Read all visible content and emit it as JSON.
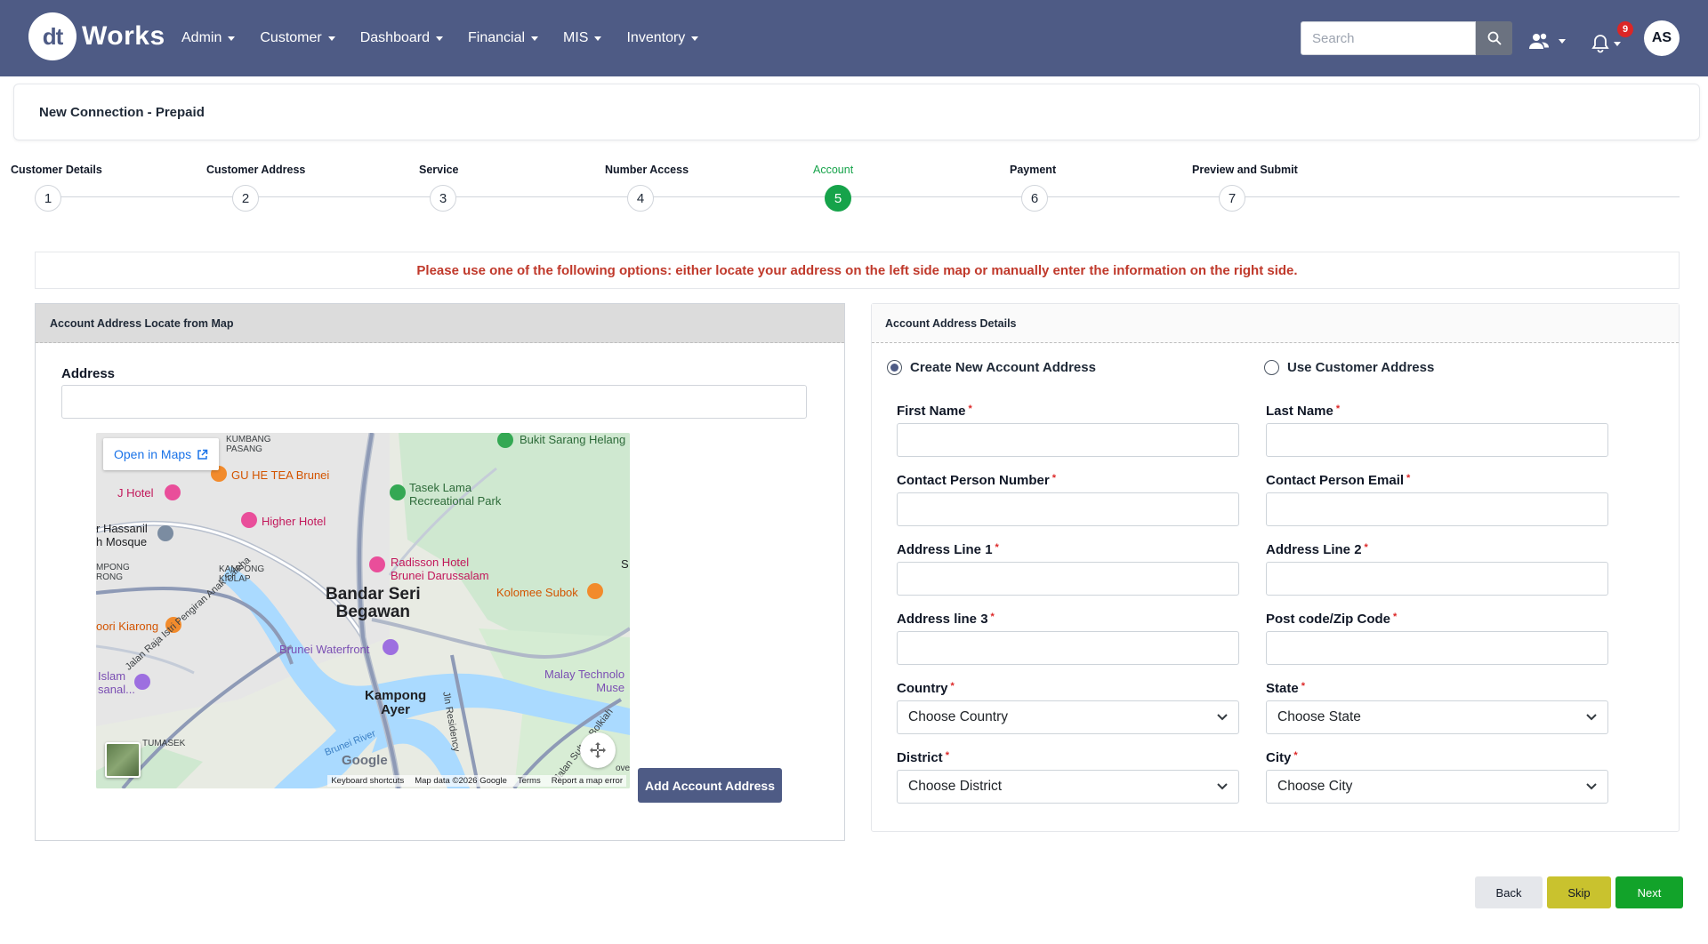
{
  "header": {
    "logo_mark": "dt",
    "logo_text": "Works",
    "nav": [
      "Admin",
      "Customer",
      "Dashboard",
      "Financial",
      "MIS",
      "Inventory"
    ],
    "search_placeholder": "Search",
    "notification_count": "9",
    "avatar_initials": "AS",
    "icons": [
      "search-icon",
      "users-icon",
      "bell-icon"
    ]
  },
  "page_title": "New Connection - Prepaid",
  "stepper": {
    "steps": [
      {
        "label": "Customer Details",
        "num": "1"
      },
      {
        "label": "Customer Address",
        "num": "2"
      },
      {
        "label": "Service",
        "num": "3"
      },
      {
        "label": "Number Access",
        "num": "4"
      },
      {
        "label": "Account",
        "num": "5"
      },
      {
        "label": "Payment",
        "num": "6"
      },
      {
        "label": "Preview and Submit",
        "num": "7"
      }
    ],
    "active_index": 4,
    "active_color": "#16a34a"
  },
  "notice": "Please use one of the following options: either locate your address on the left side map or manually enter the information on the right side.",
  "left_panel": {
    "title": "Account Address Locate from Map",
    "address_label": "Address",
    "address_value": "",
    "add_button": "Add Account Address",
    "map": {
      "open_in_maps": "Open in Maps",
      "labels": {
        "kumbang": "KUMBANG\nPASANG",
        "gu_he_tea": "GU HE TEA Brunei",
        "bukit_sarang": "Bukit Sarang Helang",
        "j_hotel": "J Hotel",
        "tasek_lama": "Tasek Lama\nRecreational Park",
        "higher_hotel": "Higher Hotel",
        "hassanil": "r Hassanil\nh Mosque",
        "radisson": "Radisson Hotel\nBrunei Darussalam",
        "s_edge": "S",
        "kampong_p": "MPONG\nRONG",
        "kampong_kiulap": "KAMPONG\nKIULAP",
        "bandar": "Bandar Seri\nBegawan",
        "kolomee": "Kolomee Subok",
        "kiarong": "oori Kiarong",
        "waterfront": "Brunei Waterfront",
        "islam": "Islam\nsanal...",
        "malay_tech": "Malay Technolo\nMuse",
        "kampong_ayer": "Kampong\nAyer",
        "tumasek": "TUMASEK",
        "jalan_raja": "Jalan Raja Istri Pengiran Anak Saleha",
        "jln_residency": "Jln Residency",
        "brunei_river": "Brunei River",
        "jalan_sultan": "Jalan Sultan Bolkiah",
        "ove": "ove"
      },
      "google": "Google",
      "footer": [
        "Keyboard shortcuts",
        "Map data ©2026 Google",
        "Terms",
        "Report a map error"
      ]
    }
  },
  "right_panel": {
    "title": "Account Address Details",
    "radio_create": "Create New Account Address",
    "radio_use": "Use Customer Address",
    "fields": {
      "first_name": "First Name",
      "last_name": "Last Name",
      "contact_number": "Contact Person Number",
      "contact_email": "Contact Person Email",
      "address1": "Address Line 1",
      "address2": "Address Line 2",
      "address3": "Address line 3",
      "postcode": "Post code/Zip Code",
      "country": "Country",
      "state": "State",
      "district": "District",
      "city": "City"
    },
    "required_mark": "*",
    "selects": {
      "country": "Choose Country",
      "state": "Choose State",
      "district": "Choose District",
      "city": "Choose City"
    }
  },
  "buttons": {
    "back": "Back",
    "skip": "Skip",
    "next": "Next"
  }
}
